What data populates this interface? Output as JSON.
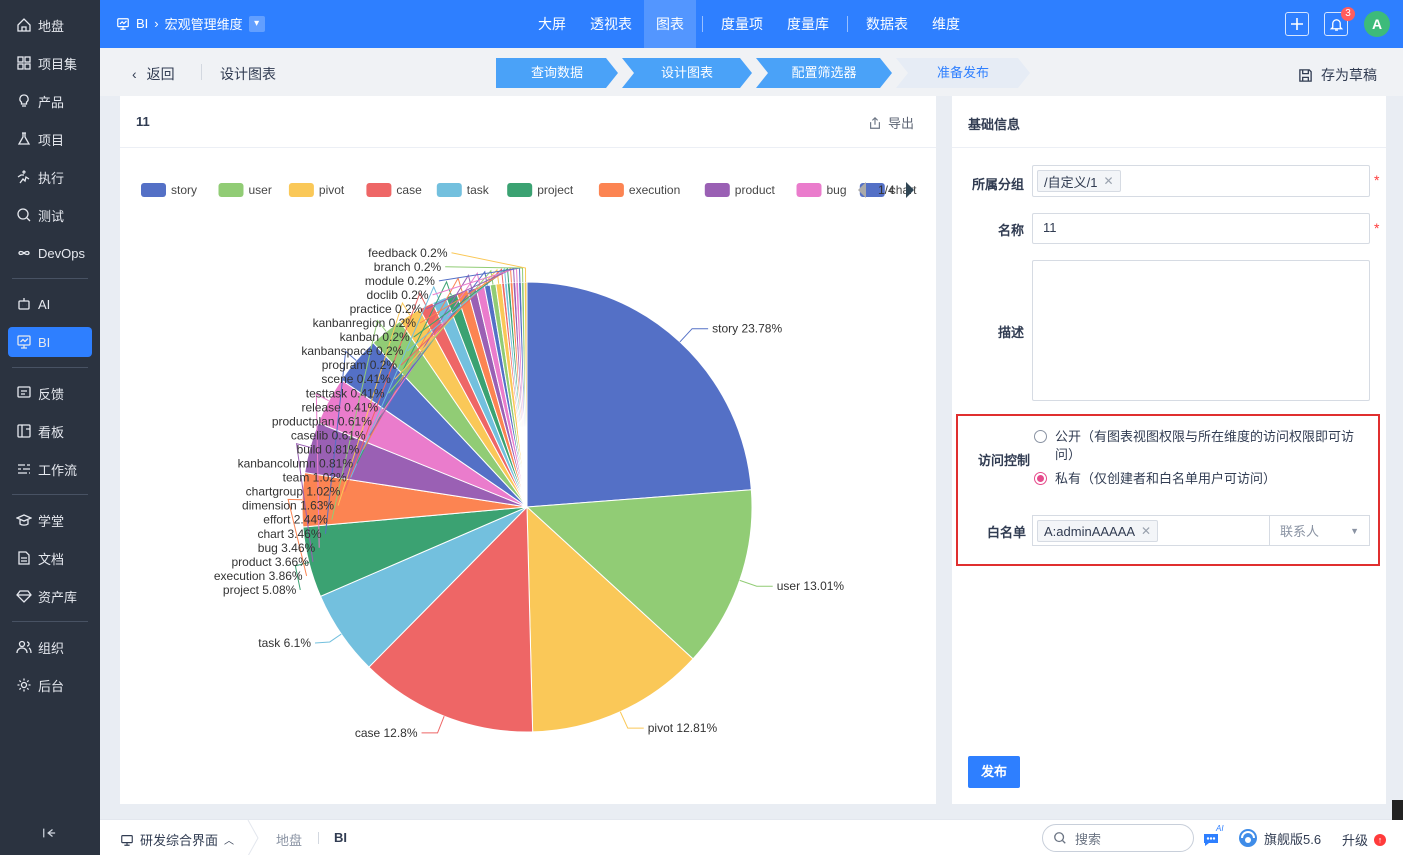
{
  "sidebar": {
    "items": [
      {
        "label": "地盘",
        "icon": "home-icon"
      },
      {
        "label": "项目集",
        "icon": "grid-icon"
      },
      {
        "label": "产品",
        "icon": "bulb-icon"
      },
      {
        "label": "项目",
        "icon": "flask-icon"
      },
      {
        "label": "执行",
        "icon": "run-icon"
      },
      {
        "label": "测试",
        "icon": "search-bug-icon"
      },
      {
        "label": "DevOps",
        "icon": "infinity-icon"
      },
      {
        "label": "AI",
        "icon": "robot-icon"
      },
      {
        "label": "BI",
        "icon": "chart-board-icon"
      },
      {
        "label": "反馈",
        "icon": "feedback-icon"
      },
      {
        "label": "看板",
        "icon": "kanban-icon"
      },
      {
        "label": "工作流",
        "icon": "workflow-icon"
      },
      {
        "label": "学堂",
        "icon": "graduation-icon"
      },
      {
        "label": "文档",
        "icon": "doc-icon"
      },
      {
        "label": "资产库",
        "icon": "diamond-icon"
      },
      {
        "label": "组织",
        "icon": "people-icon"
      },
      {
        "label": "后台",
        "icon": "settings-icon"
      }
    ],
    "active": "BI"
  },
  "topbar": {
    "breadcrumb_root": "BI",
    "breadcrumb_current": "宏观管理维度",
    "nav": [
      "大屏",
      "透视表",
      "图表",
      "度量项",
      "度量库",
      "数据表",
      "维度"
    ],
    "active_nav": "图表",
    "notification_count": "3",
    "avatar_letter": "A"
  },
  "subheader": {
    "back_label": "返回",
    "title": "设计图表",
    "steps": [
      "查询数据",
      "设计图表",
      "配置筛选器",
      "准备发布"
    ],
    "save_draft": "存为草稿"
  },
  "chart_panel": {
    "title": "11",
    "export_label": "导出",
    "legend_page": "1/4"
  },
  "chart_data": {
    "type": "pie",
    "legend": [
      "story",
      "user",
      "pivot",
      "case",
      "task",
      "project",
      "execution",
      "product",
      "bug",
      "chart"
    ],
    "slices": [
      {
        "name": "story",
        "value": 23.78,
        "label": "story 23.78%"
      },
      {
        "name": "user",
        "value": 13.01,
        "label": "user 13.01%"
      },
      {
        "name": "pivot",
        "value": 12.81,
        "label": "pivot 12.81%"
      },
      {
        "name": "case",
        "value": 12.8,
        "label": "case 12.8%"
      },
      {
        "name": "task",
        "value": 6.1,
        "label": "task 6.1%"
      },
      {
        "name": "project",
        "value": 5.08,
        "label": "project 5.08%"
      },
      {
        "name": "execution",
        "value": 3.86,
        "label": "execution 3.86%"
      },
      {
        "name": "product",
        "value": 3.66,
        "label": "product 3.66%"
      },
      {
        "name": "bug",
        "value": 3.46,
        "label": "bug 3.46%"
      },
      {
        "name": "chart",
        "value": 3.46,
        "label": "chart 3.46%"
      },
      {
        "name": "effort",
        "value": 2.44,
        "label": "effort 2.44%"
      },
      {
        "name": "dimension",
        "value": 1.63,
        "label": "dimension 1.63%"
      },
      {
        "name": "chartgroup",
        "value": 1.02,
        "label": "chartgroup 1.02%"
      },
      {
        "name": "team",
        "value": 1.02,
        "label": "team 1.02%"
      },
      {
        "name": "kanbancolumn",
        "value": 0.81,
        "label": "kanbancolumn 0.81%"
      },
      {
        "name": "build",
        "value": 0.81,
        "label": "build 0.81%"
      },
      {
        "name": "caselib",
        "value": 0.61,
        "label": "caselib 0.61%"
      },
      {
        "name": "productplan",
        "value": 0.61,
        "label": "productplan 0.61%"
      },
      {
        "name": "release",
        "value": 0.41,
        "label": "release 0.41%"
      },
      {
        "name": "testtask",
        "value": 0.41,
        "label": "testtask 0.41%"
      },
      {
        "name": "scene",
        "value": 0.41,
        "label": "scene 0.41%"
      },
      {
        "name": "program",
        "value": 0.2,
        "label": "program 0.2%"
      },
      {
        "name": "kanbanspace",
        "value": 0.2,
        "label": "kanbanspace 0.2%"
      },
      {
        "name": "kanban",
        "value": 0.2,
        "label": "kanban 0.2%"
      },
      {
        "name": "kanbanregion",
        "value": 0.2,
        "label": "kanbanregion 0.2%"
      },
      {
        "name": "practice",
        "value": 0.2,
        "label": "practice 0.2%"
      },
      {
        "name": "doclib",
        "value": 0.2,
        "label": "doclib 0.2%"
      },
      {
        "name": "module",
        "value": 0.2,
        "label": "module 0.2%"
      },
      {
        "name": "branch",
        "value": 0.2,
        "label": "branch 0.2%"
      },
      {
        "name": "feedback",
        "value": 0.2,
        "label": "feedback 0.2%"
      }
    ],
    "colors": [
      "#5470c6",
      "#91cc75",
      "#fac858",
      "#ee6666",
      "#73c0de",
      "#3ba272",
      "#fc8452",
      "#9a60b4",
      "#ea7ccc"
    ]
  },
  "form": {
    "section_title": "基础信息",
    "group_label": "所属分组",
    "group_value": "/自定义/1",
    "name_label": "名称",
    "name_value": "11",
    "desc_label": "描述",
    "desc_value": "",
    "access_label": "访问控制",
    "access_public": "公开（有图表视图权限与所在维度的访问权限即可访问）",
    "access_private": "私有（仅创建者和白名单用户可访问）",
    "access_selected": "private",
    "whitelist_label": "白名单",
    "whitelist_value": "A:adminAAAAA",
    "contacts_placeholder": "联系人",
    "publish_label": "发布",
    "required_mark": "*"
  },
  "bottombar": {
    "workspace": "研发综合界面",
    "crumbs": [
      "地盘",
      "BI"
    ],
    "search_placeholder": "搜索",
    "edition": "旗舰版5.6",
    "upgrade": "升级",
    "ai_label": "AI"
  }
}
